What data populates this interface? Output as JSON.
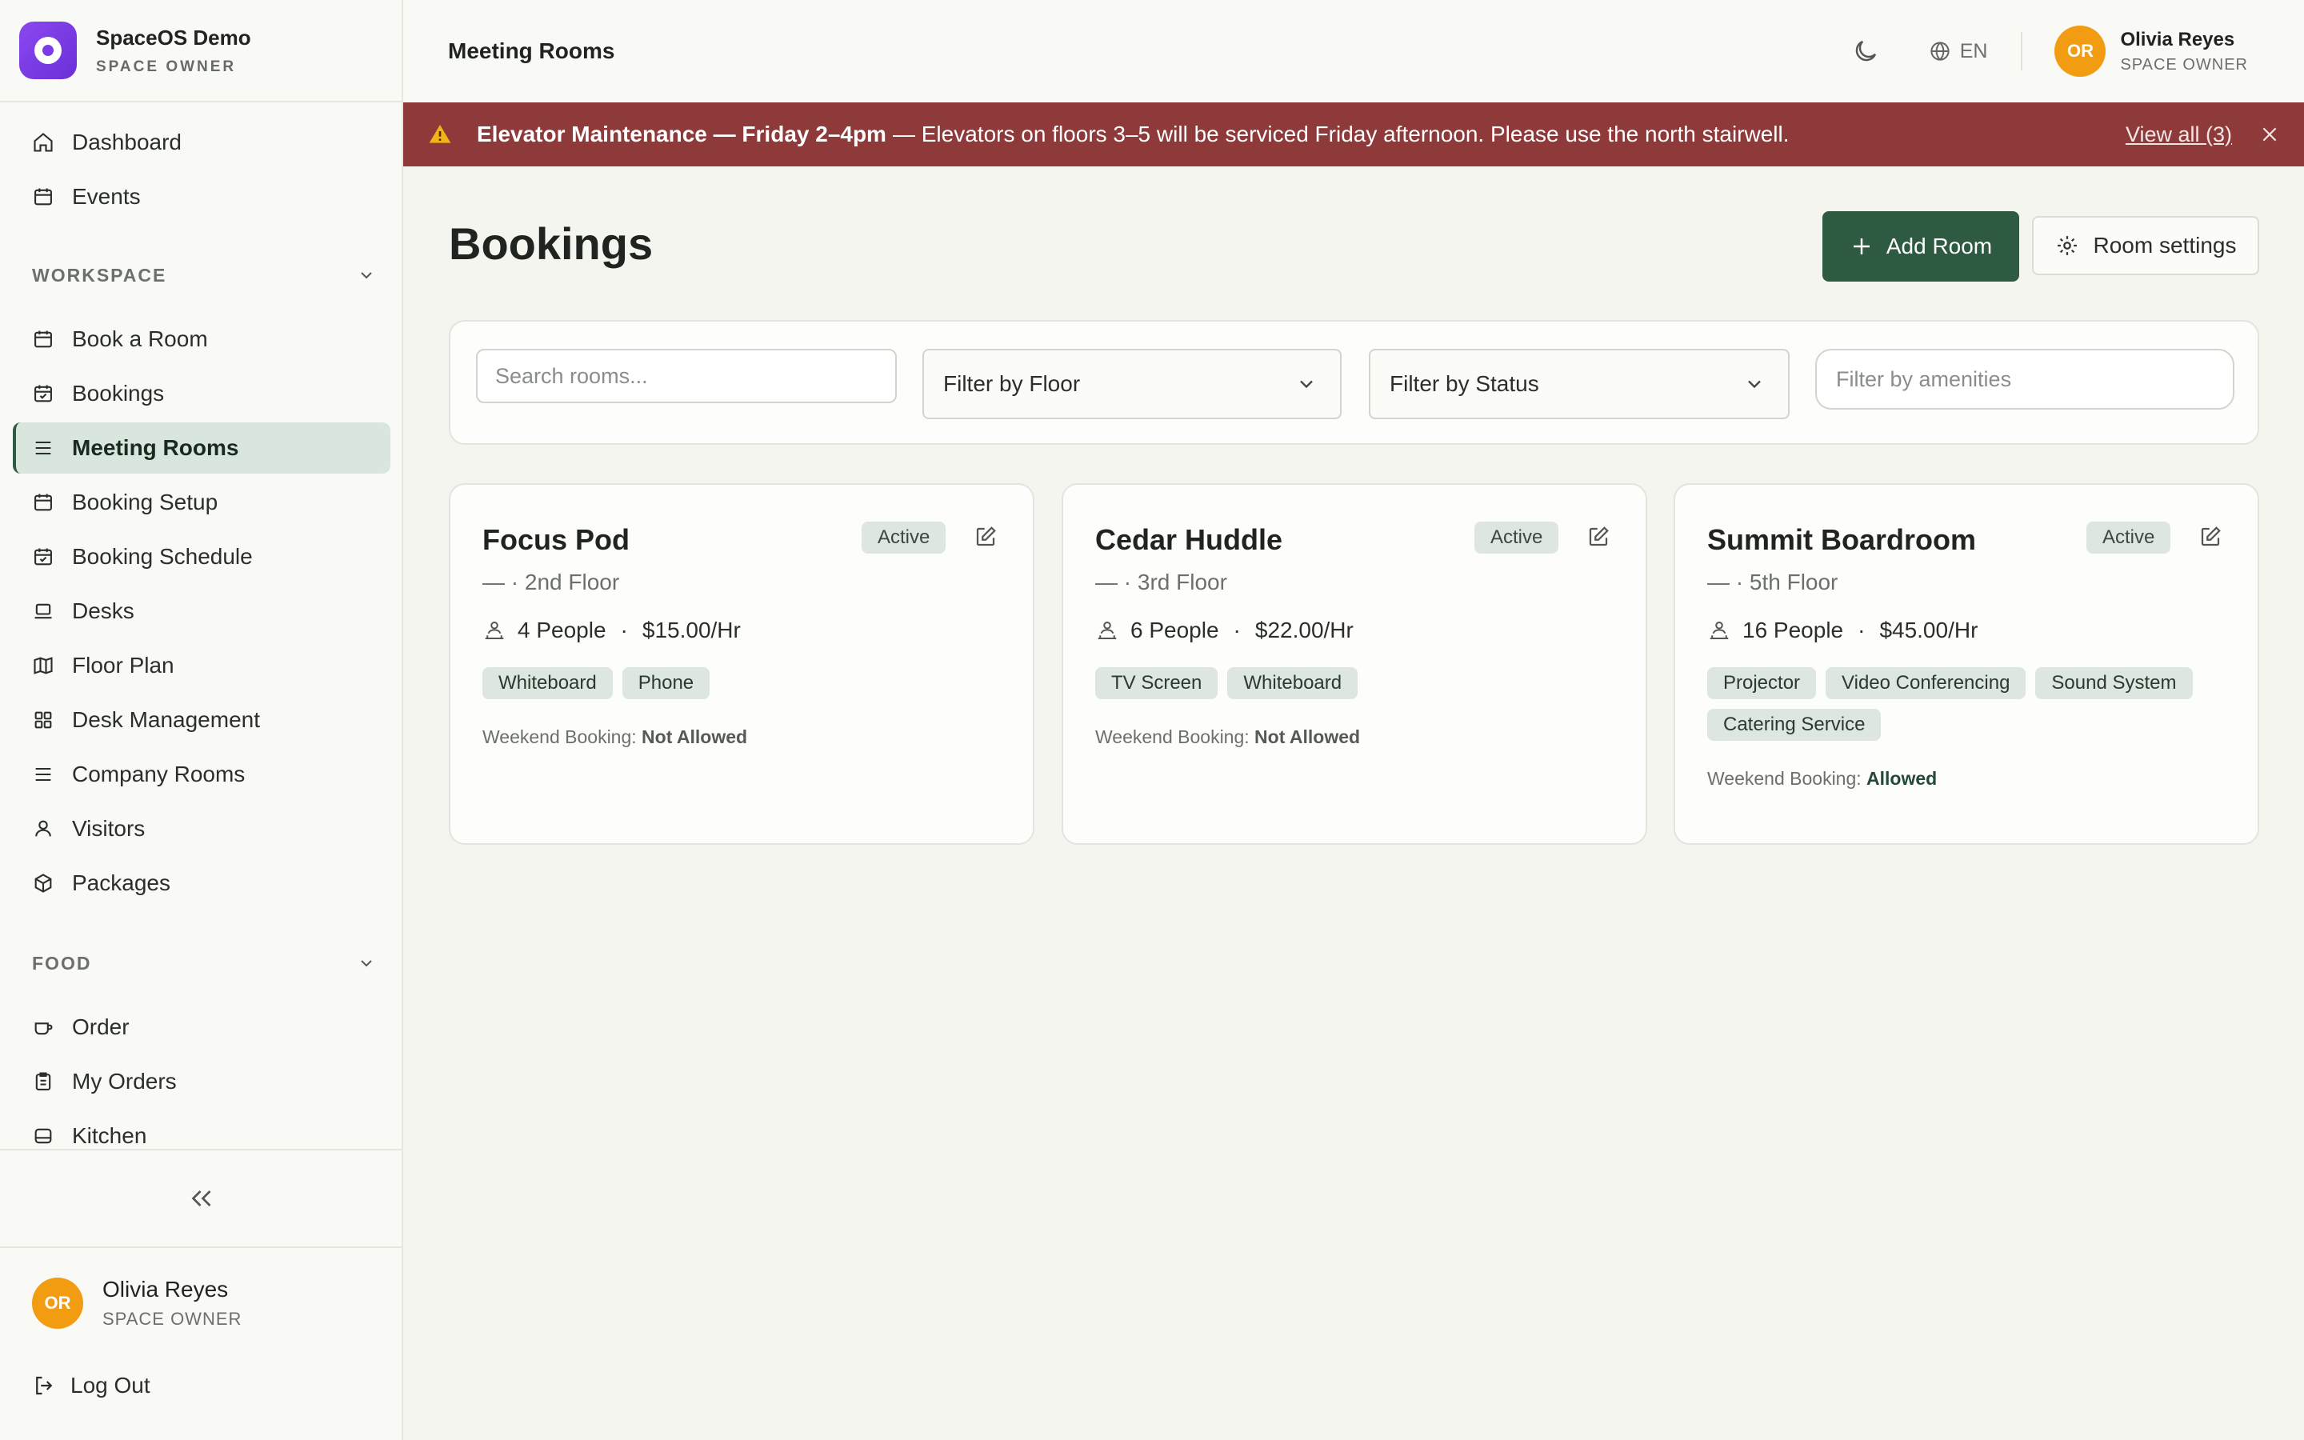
{
  "brand": {
    "name": "SpaceOS Demo",
    "role": "SPACE OWNER"
  },
  "sidebar": {
    "top_items": [
      {
        "label": "Dashboard",
        "icon": "home-icon"
      },
      {
        "label": "Events",
        "icon": "calendar-icon"
      }
    ],
    "workspace": {
      "heading": "WORKSPACE",
      "items": [
        {
          "label": "Book a Room",
          "icon": "calendar-icon"
        },
        {
          "label": "Bookings",
          "icon": "calendar-check-icon"
        },
        {
          "label": "Meeting Rooms",
          "icon": "list-icon",
          "active": true
        },
        {
          "label": "Booking Setup",
          "icon": "calendar-icon"
        },
        {
          "label": "Booking Schedule",
          "icon": "calendar-check-icon"
        },
        {
          "label": "Desks",
          "icon": "laptop-icon"
        },
        {
          "label": "Floor Plan",
          "icon": "map-icon"
        },
        {
          "label": "Desk Management",
          "icon": "grid-icon"
        },
        {
          "label": "Company Rooms",
          "icon": "list-icon"
        },
        {
          "label": "Visitors",
          "icon": "user-icon"
        },
        {
          "label": "Packages",
          "icon": "package-icon"
        }
      ]
    },
    "food": {
      "heading": "FOOD",
      "items": [
        {
          "label": "Order",
          "icon": "cup-icon"
        },
        {
          "label": "My Orders",
          "icon": "clipboard-icon"
        },
        {
          "label": "Kitchen",
          "icon": "kitchen-icon"
        }
      ]
    },
    "user": {
      "initials": "OR",
      "name": "Olivia Reyes",
      "role": "SPACE OWNER"
    },
    "logout_label": "Log Out"
  },
  "topbar": {
    "title": "Meeting Rooms",
    "language": "EN",
    "user": {
      "initials": "OR",
      "name": "Olivia Reyes",
      "role": "SPACE OWNER"
    }
  },
  "banner": {
    "title": "Elevator Maintenance — Friday 2–4pm",
    "message": "— Elevators on floors 3–5 will be serviced Friday afternoon. Please use the north stairwell.",
    "view_all": "View all (3)",
    "color": "#8f3a3a"
  },
  "main": {
    "heading": "Bookings",
    "add_room_label": "Add Room",
    "room_settings_label": "Room settings",
    "search_placeholder": "Search rooms...",
    "floor_filter": "Filter by Floor",
    "status_filter": "Filter by Status",
    "amenities_placeholder": "Filter by amenities"
  },
  "rooms": [
    {
      "name": "Focus Pod",
      "status": "Active",
      "floor": "— · 2nd Floor",
      "people": "4 People",
      "price": "$15.00/Hr",
      "amenities": [
        "Whiteboard",
        "Phone"
      ],
      "weekend_label": "Weekend Booking:",
      "weekend_value": "Not Allowed"
    },
    {
      "name": "Cedar Huddle",
      "status": "Active",
      "floor": "— · 3rd Floor",
      "people": "6 People",
      "price": "$22.00/Hr",
      "amenities": [
        "TV Screen",
        "Whiteboard"
      ],
      "weekend_label": "Weekend Booking:",
      "weekend_value": "Not Allowed"
    },
    {
      "name": "Summit Boardroom",
      "status": "Active",
      "floor": "— · 5th Floor",
      "people": "16 People",
      "price": "$45.00/Hr",
      "amenities": [
        "Projector",
        "Video Conferencing",
        "Sound System",
        "Catering Service"
      ],
      "weekend_label": "Weekend Booking:",
      "weekend_value": "Allowed"
    }
  ],
  "colors": {
    "accent": "#2d5a40",
    "active_nav": "#d9e6dd",
    "avatar": "#f29c11",
    "brand": "#7a3ce6"
  }
}
